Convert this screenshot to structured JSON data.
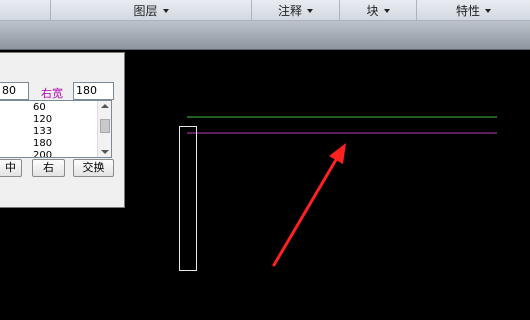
{
  "ribbon": {
    "panels": [
      {
        "label": "图层"
      },
      {
        "label": "注释"
      },
      {
        "label": "块"
      },
      {
        "label": "特性"
      }
    ]
  },
  "dialog": {
    "left_width_value": "80",
    "right_width_label": "右宽",
    "right_width_value": "180",
    "width_options": [
      "60",
      "120",
      "133",
      "180",
      "200"
    ],
    "buttons": {
      "center": "中",
      "right": "右",
      "swap": "交换"
    }
  },
  "drawing": {
    "colors": {
      "green_line": "#3fbf3f",
      "magenta_line": "#c040c0",
      "rectangle": "#e6e6e6",
      "arrow": "#ff2020"
    }
  },
  "colors": {
    "canvas_bg": "#000000",
    "label_magenta": "#b000b0"
  }
}
